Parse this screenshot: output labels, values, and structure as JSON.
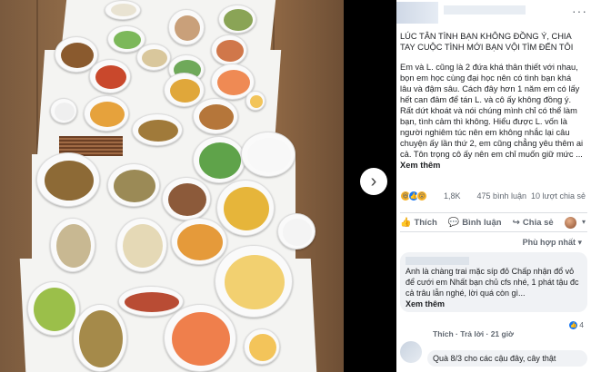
{
  "post": {
    "title": "LÚC TÂN TÌNH BẠN KHÔNG ĐỒNG Ý, CHIA TAY CUỘC TÌNH MỚI BẠN VỘI TÌM ĐẾN TÔI",
    "body": "Em và L. cũng là 2 đứa khá thân thiết với nhau, bọn em học cùng đại học nên có tình bạn khá lâu và đậm sâu. Cách đây hơn 1 năm em có lấy hết can đảm để tán L. và cô ấy không đồng ý. Rất dứt khoát và nói chúng mình chỉ có thể làm bạn, tình cảm thì không. Hiểu được L. vốn là người nghiêm túc nên em không nhắc lại câu chuyện ấy lần thứ 2, em cũng chẳng yêu thêm ai cả. Tôn trọng cô ấy nên em chỉ muốn giữ mức ...",
    "see_more": "Xem thêm",
    "menu_icon": "···"
  },
  "reactions": {
    "count": "1,8K",
    "comments": "475 bình luận",
    "shares": "10 lượt chia sẻ"
  },
  "actions": {
    "like": "Thích",
    "comment": "Bình luận",
    "share": "Chia sẻ"
  },
  "sort_label": "Phù hợp nhất",
  "comments": [
    {
      "text": "Anh là chàng trai mặc síp đỏ Chấp nhận đổ vỏ để cưới em Nhất bạn chủ cfs nhé, 1 phát tậu đc cả trâu lẫn nghé, lời quá còn gì...",
      "see_more": "Xem thêm",
      "like": "Thích",
      "reply": "Trả lời",
      "time": "21 giờ",
      "reacts": "4"
    },
    {
      "text": "Quà 8/3 cho các cậu đây, cây thật"
    }
  ],
  "icons": {
    "next": "chevron-right-icon",
    "like": "thumbs-up-icon",
    "comment": "speech-bubble-icon",
    "share": "share-arrow-icon"
  },
  "colors": {
    "fb_blue": "#1877f2",
    "muted": "#606770",
    "bubble": "#f0f2f5"
  }
}
